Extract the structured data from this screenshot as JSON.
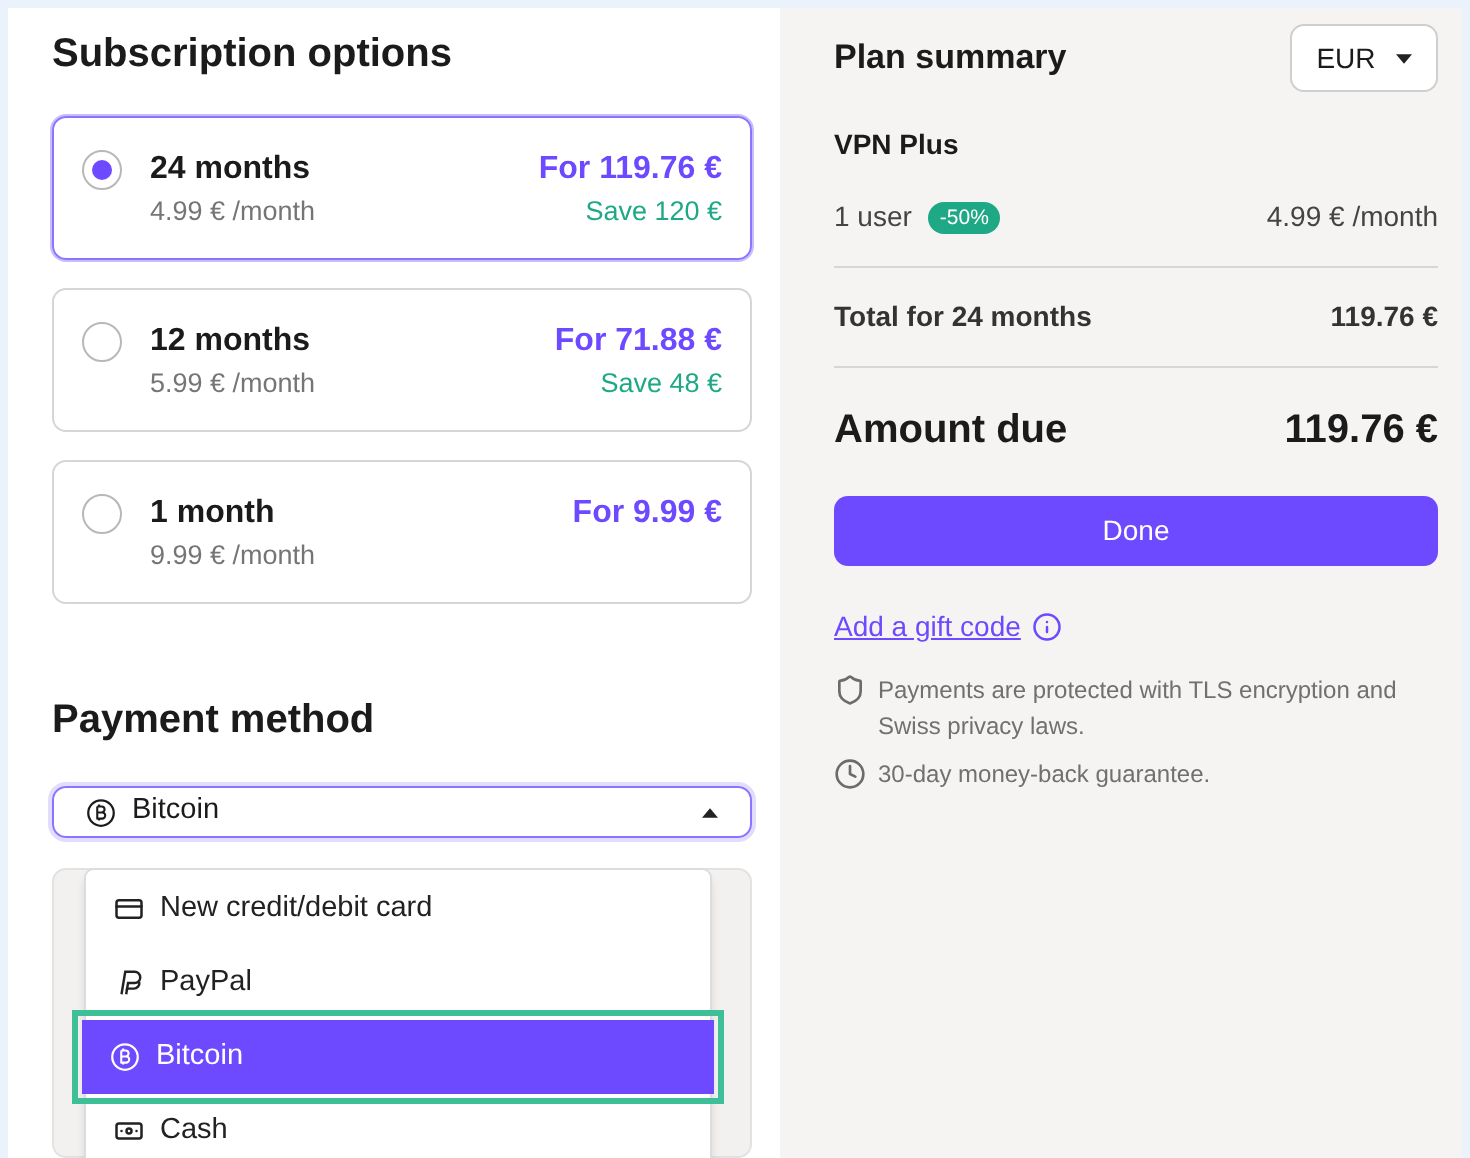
{
  "subscription": {
    "title": "Subscription options",
    "options": [
      {
        "name": "24 months",
        "monthly": "4.99 € /month",
        "price": "For 119.76 €",
        "saving": "Save 120 €",
        "selected": true
      },
      {
        "name": "12 months",
        "monthly": "5.99 € /month",
        "price": "For 71.88 €",
        "saving": "Save 48 €",
        "selected": false
      },
      {
        "name": "1 month",
        "monthly": "9.99 € /month",
        "price": "For 9.99 €",
        "selected": false
      }
    ]
  },
  "payment": {
    "title": "Payment method",
    "select": {
      "value": "Bitcoin",
      "kind": "bitcoin",
      "expanded": true
    },
    "menu": [
      {
        "label": "New credit/debit card",
        "kind": "card",
        "selected": false
      },
      {
        "label": "PayPal",
        "kind": "paypal",
        "selected": false
      },
      {
        "label": "Bitcoin",
        "kind": "bitcoin",
        "selected": true
      },
      {
        "label": "Cash",
        "kind": "cash",
        "selected": false
      }
    ]
  },
  "summary": {
    "title": "Plan summary",
    "currency": "EUR",
    "plan": "VPN Plus",
    "users": "1 user",
    "discount": "-50%",
    "unit_price": "4.99 € /month",
    "total_label": "Total for 24 months",
    "total": "119.76 €",
    "due_label": "Amount due",
    "due": "119.76 €",
    "button": "Done",
    "gift_link": "Add a gift code",
    "notes": [
      {
        "kind": "shield",
        "text": "Payments are protected with TLS encryption and Swiss privacy laws."
      },
      {
        "kind": "clock",
        "text": "30-day money-back guarantee."
      }
    ]
  }
}
